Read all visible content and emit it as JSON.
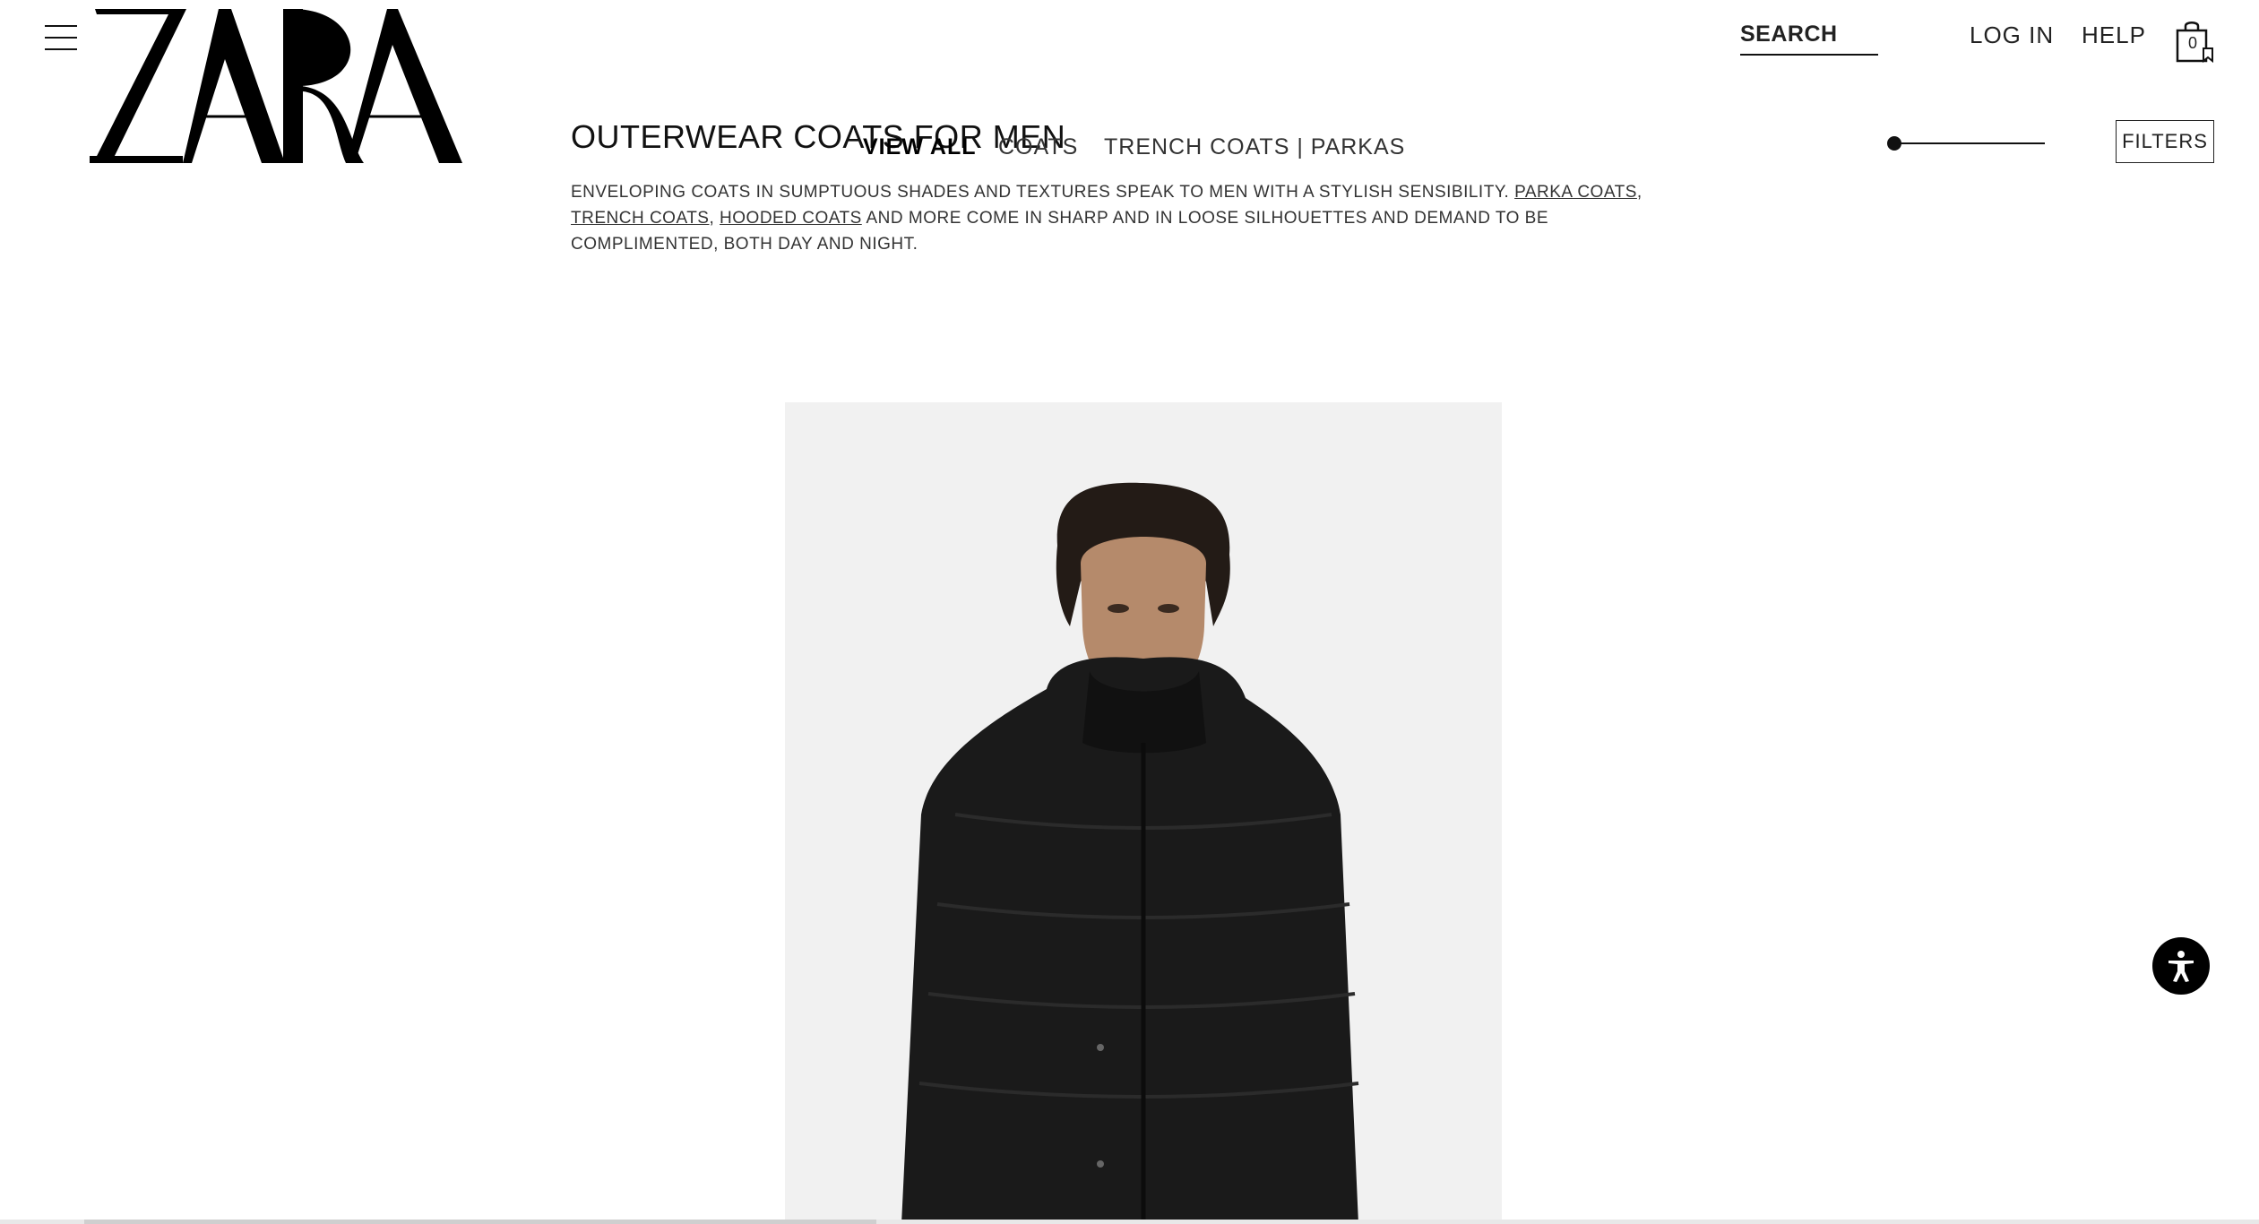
{
  "brand": {
    "logo_text": "ZARA"
  },
  "header": {
    "search_label": "SEARCH",
    "login_label": "LOG IN",
    "help_label": "HELP",
    "bag_count": "0"
  },
  "page": {
    "title": "OUTERWEAR COATS FOR MEN",
    "description_part1": "ENVELOPING COATS IN SUMPTUOUS SHADES AND TEXTURES SPEAK TO MEN WITH A STYLISH SENSIBILITY. ",
    "link_parka": "PARKA COATS",
    "sep1": ", ",
    "link_trench": "TRENCH COATS",
    "sep2": ", ",
    "link_hooded": "HOODED COATS",
    "description_part2": " AND MORE COME IN SHARP AND IN LOOSE SILHOUETTES AND DEMAND TO BE COMPLIMENTED, BOTH DAY AND NIGHT."
  },
  "subnav": {
    "tabs": [
      {
        "label": "VIEW ALL",
        "active": true
      },
      {
        "label": "COATS",
        "active": false
      },
      {
        "label": "TRENCH COATS | PARKAS",
        "active": false
      }
    ]
  },
  "toolbar": {
    "filters_label": "FILTERS",
    "zoom_level": 0
  },
  "icons": {
    "menu": "hamburger-menu-icon",
    "bag": "shopping-bag-icon",
    "accessibility": "accessibility-icon"
  },
  "colors": {
    "text": "#000000",
    "background": "#ffffff",
    "image_bg": "#f1f1f1",
    "jacket": "#1a1a1a"
  }
}
